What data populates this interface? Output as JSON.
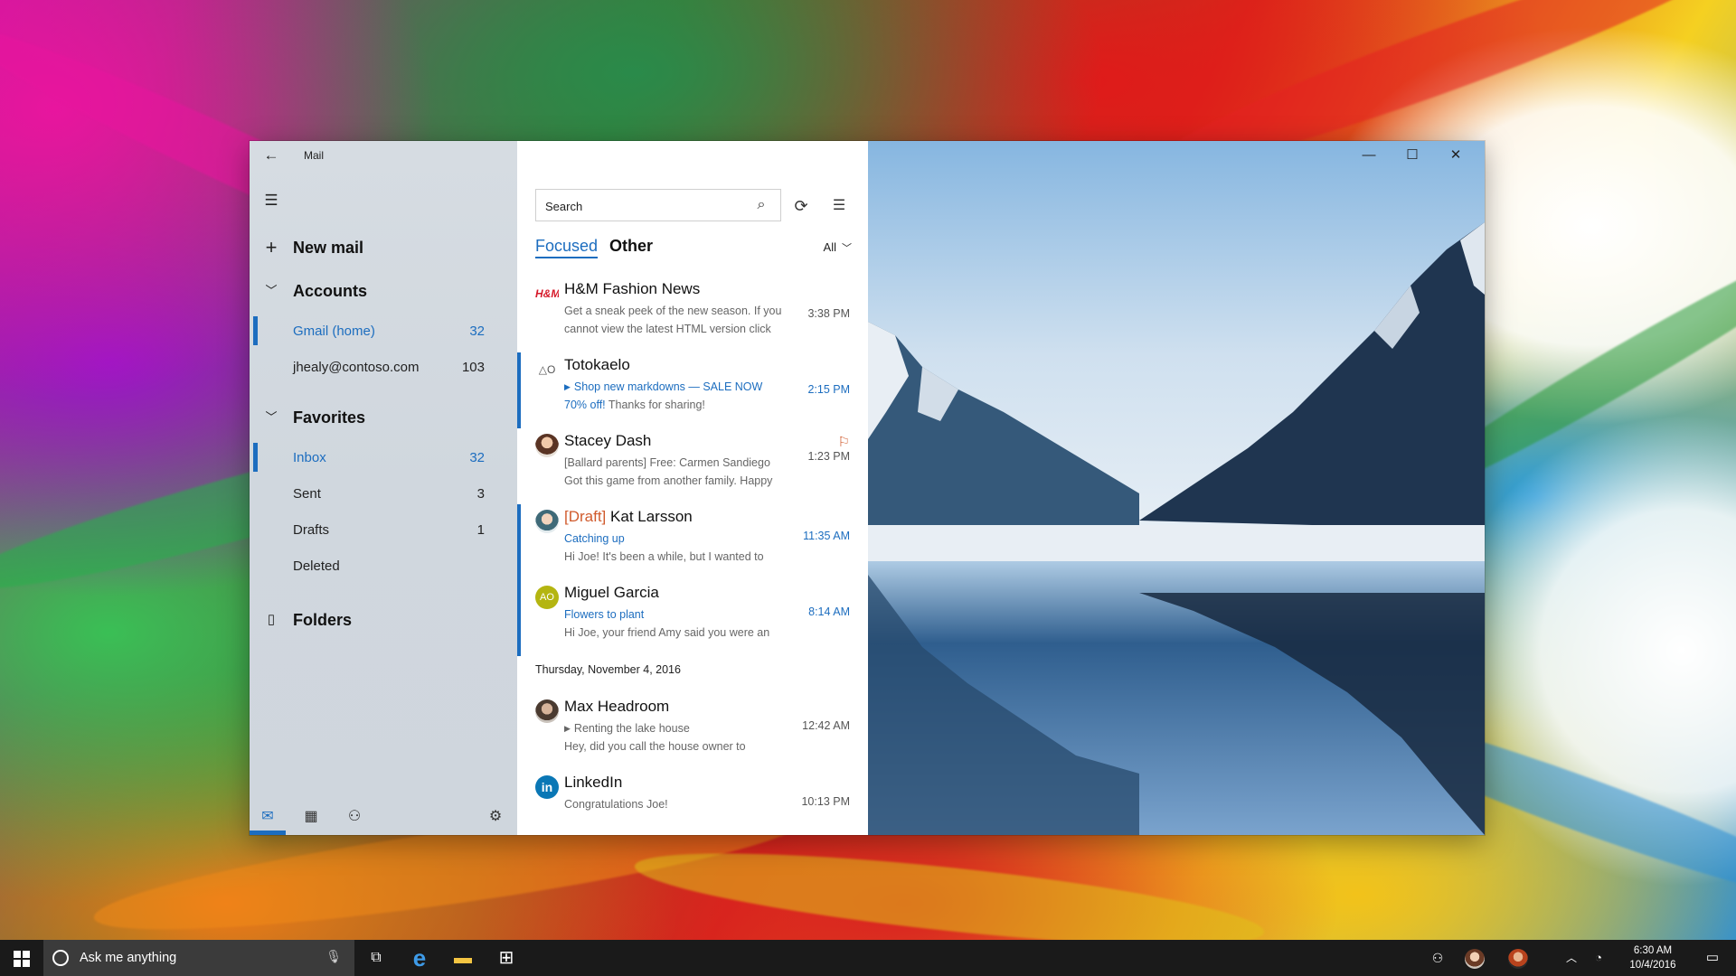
{
  "window": {
    "app_title": "Mail",
    "controls": {
      "minimize": "—",
      "maximize": "☐",
      "close": "✕"
    }
  },
  "nav": {
    "new_mail": "New mail",
    "accounts_header": "Accounts",
    "accounts": [
      {
        "label": "Gmail (home)",
        "count": "32",
        "active": true
      },
      {
        "label": "jhealy@contoso.com",
        "count": "103",
        "active": false
      }
    ],
    "favorites_header": "Favorites",
    "favorites": [
      {
        "label": "Inbox",
        "count": "32",
        "active": true
      },
      {
        "label": "Sent",
        "count": "3",
        "active": false
      },
      {
        "label": "Drafts",
        "count": "1",
        "active": false
      },
      {
        "label": "Deleted",
        "count": "",
        "active": false
      }
    ],
    "folders": "Folders",
    "bottom": {
      "mail_icon": "mail-icon",
      "calendar_icon": "calendar-icon",
      "people_icon": "people-icon",
      "settings_icon": "gear-icon"
    }
  },
  "list": {
    "search": {
      "placeholder": "Search",
      "value": ""
    },
    "tabs": {
      "focused": "Focused",
      "other": "Other"
    },
    "filter": "All",
    "messages": [
      {
        "sender": "H&M Fashion News",
        "draft_prefix": "",
        "line1": "Get a sneak peek of the new season. If you",
        "line2": "cannot view the latest HTML version click",
        "time": "3:38 PM",
        "avatar_text": "H&M"
      },
      {
        "sender": "Totokaelo",
        "draft_prefix": "",
        "line1": "Shop new markdowns — SALE NOW",
        "line2_blue": "70% off!",
        "line2": " Thanks for sharing!",
        "time": "2:15 PM",
        "avatar_text": "△O"
      },
      {
        "sender": "Stacey Dash",
        "draft_prefix": "",
        "line1": "[Ballard parents] Free: Carmen Sandiego",
        "line2": "Got this game from another family. Happy",
        "time": "1:23 PM"
      },
      {
        "sender": "Kat Larsson",
        "draft_prefix": "[Draft]",
        "line1": "Catching up",
        "line2": "Hi Joe! It's been a while, but I wanted to",
        "time": "11:35 AM"
      },
      {
        "sender": "Miguel Garcia",
        "draft_prefix": "",
        "line1": "Flowers to plant",
        "line2": "Hi Joe, your friend Amy said you were an",
        "time": "8:14 AM",
        "avatar_text": "AO"
      },
      {
        "sender": "Max Headroom",
        "draft_prefix": "",
        "line1": "Renting the lake house",
        "line2": "Hey, did you call the house owner to",
        "time": "12:42 AM"
      },
      {
        "sender": "LinkedIn",
        "draft_prefix": "",
        "line1": "Congratulations Joe!",
        "line2": "",
        "time": "10:13 PM",
        "avatar_text": "in"
      }
    ],
    "date_header": "Thursday, November 4, 2016"
  },
  "taskbar": {
    "search_placeholder": "Ask me anything",
    "clock_time": "6:30 AM",
    "clock_date": "10/4/2016"
  },
  "colors": {
    "accent": "#1c6dbf",
    "draft": "#d05a2c",
    "nav_bg": "#d3d9df",
    "taskbar": "#1a1a1a"
  }
}
